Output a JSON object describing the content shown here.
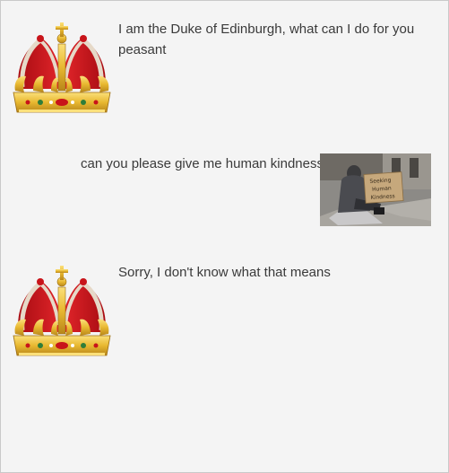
{
  "chat": {
    "messages": [
      {
        "sender": "bot",
        "avatar_icon": "crown-icon",
        "text": "I am the Duke of Edinburgh, what can I do for you peasant"
      },
      {
        "sender": "user",
        "avatar_icon": "homeless-person-photo",
        "text": "can you please give me human kindness",
        "photo_sign_text": "Seeking Human Kindness"
      },
      {
        "sender": "bot",
        "avatar_icon": "crown-icon",
        "text": "Sorry, I don't know what that means"
      }
    ]
  },
  "colors": {
    "background": "#f4f4f4",
    "text": "#3a3a3a",
    "crown_red": "#d4161c",
    "crown_gold": "#e8b830"
  }
}
